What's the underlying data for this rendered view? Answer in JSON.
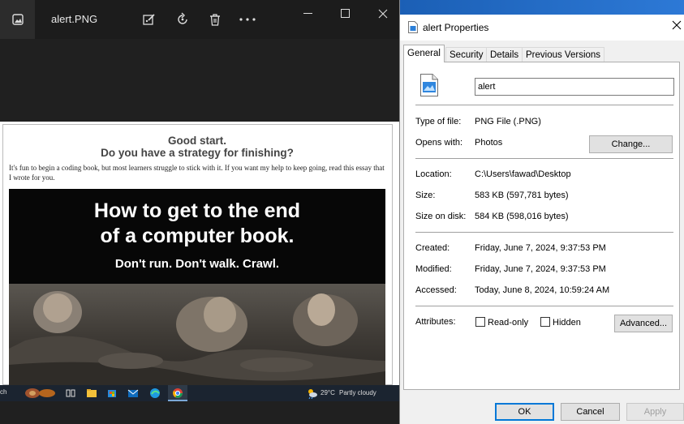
{
  "photos": {
    "filename": "alert.PNG",
    "toolbar_icons": [
      "edit-icon",
      "rotate-icon",
      "delete-icon",
      "more-icon"
    ],
    "window_icons": [
      "minimize-icon",
      "maximize-icon",
      "close-icon"
    ],
    "document": {
      "title_line1": "Good start.",
      "title_line2": "Do you have a strategy for finishing?",
      "paragraph": "It's fun to begin a coding book, but most learners struggle to stick with it. If you want my help to keep going, read this essay that I wrote for you.",
      "banner_line1": "How to get to the end",
      "banner_line2": "of a computer book.",
      "banner_subtitle": "Don't run. Don't walk. Crawl."
    },
    "taskbar": {
      "search_cut": "ch",
      "temperature": "29°C",
      "weather": "Partly cloudy"
    }
  },
  "properties": {
    "title": "alert Properties",
    "tabs": [
      "General",
      "Security",
      "Details",
      "Previous Versions"
    ],
    "active_tab": "General",
    "file_name": "alert",
    "type_label": "Type of file:",
    "type_value": "PNG File (.PNG)",
    "opens_label": "Opens with:",
    "opens_value": "Photos",
    "change_button": "Change...",
    "location_label": "Location:",
    "location_value": "C:\\Users\\fawad\\Desktop",
    "size_label": "Size:",
    "size_value": "583 KB (597,781 bytes)",
    "size_disk_label": "Size on disk:",
    "size_disk_value": "584 KB (598,016 bytes)",
    "created_label": "Created:",
    "created_value": "Friday, June 7, 2024, 9:37:53 PM",
    "modified_label": "Modified:",
    "modified_value": "Friday, June 7, 2024, 9:37:53 PM",
    "accessed_label": "Accessed:",
    "accessed_value": "Today, June 8, 2024, 10:59:24 AM",
    "attributes_label": "Attributes:",
    "readonly_label": "Read-only",
    "hidden_label": "Hidden",
    "advanced_button": "Advanced...",
    "ok_button": "OK",
    "cancel_button": "Cancel",
    "apply_button": "Apply"
  }
}
